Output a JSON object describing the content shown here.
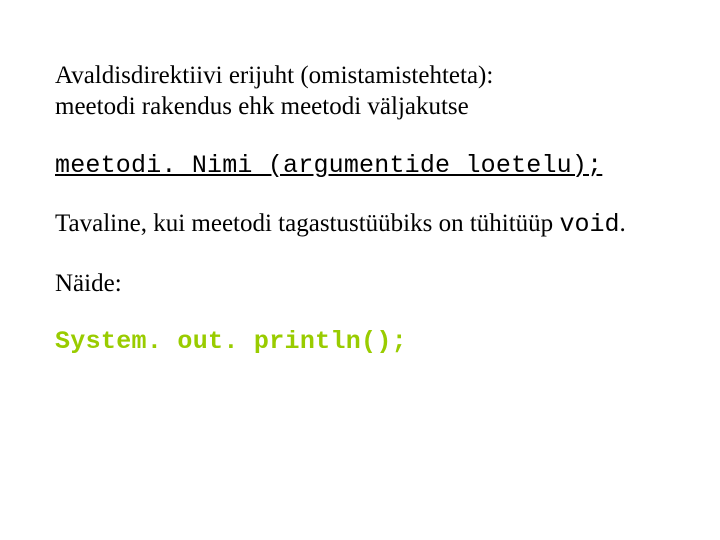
{
  "slide": {
    "title_line1": "Avaldisdirektiivi erijuht (omistamistehteta):",
    "title_line2": "meetodi rakendus ehk meetodi väljakutse",
    "syntax": "meetodi. Nimi (argumentide loetelu);",
    "body_text": "Tavaline, kui meetodi tagastustüübiks on tühitüüp ",
    "body_code": "void",
    "body_period": ".",
    "example_label": "Näide:",
    "example_code": "System. out. println();"
  }
}
